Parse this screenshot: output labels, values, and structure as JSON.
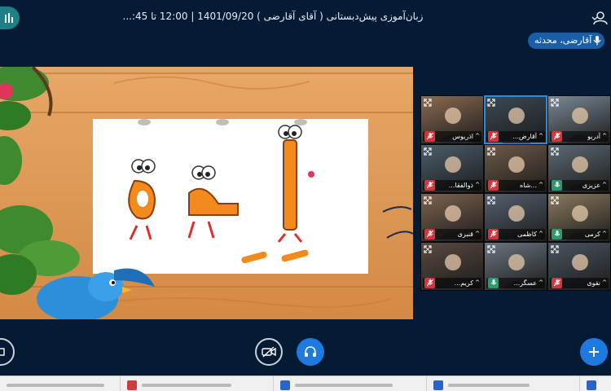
{
  "header": {
    "title": "زبان‌آموزی پیش‌دبستانی ( آقای آقارضی ) 1401/09/20 | 12:00 تا 45:..."
  },
  "presenter": {
    "name": "آقارضی، محدثه"
  },
  "participants": [
    {
      "name": "آدریو",
      "mic": "muted"
    },
    {
      "name": "آقارض...",
      "mic": "muted"
    },
    {
      "name": "اذریوس",
      "mic": "muted"
    },
    {
      "name": "عزیزی",
      "mic": "unmuted"
    },
    {
      "name": "...شاه",
      "mic": "muted"
    },
    {
      "name": "ذوالفقا...",
      "mic": "muted"
    },
    {
      "name": "کرمی",
      "mic": "unmuted"
    },
    {
      "name": "کاظمی",
      "mic": "muted"
    },
    {
      "name": "قنبری",
      "mic": "muted"
    },
    {
      "name": "نقوی",
      "mic": "muted"
    },
    {
      "name": "عسگر...",
      "mic": "unmuted"
    },
    {
      "name": "کریم...",
      "mic": "muted"
    }
  ],
  "controls": {
    "left": "actions-icon",
    "video": "video-off-icon",
    "audio": "headphones-icon",
    "add": "plus-icon"
  },
  "colors": {
    "accent": "#1f7ae0",
    "topbar": "#041a35",
    "muted": "#d8333a",
    "unmuted": "#2b9a6d"
  }
}
